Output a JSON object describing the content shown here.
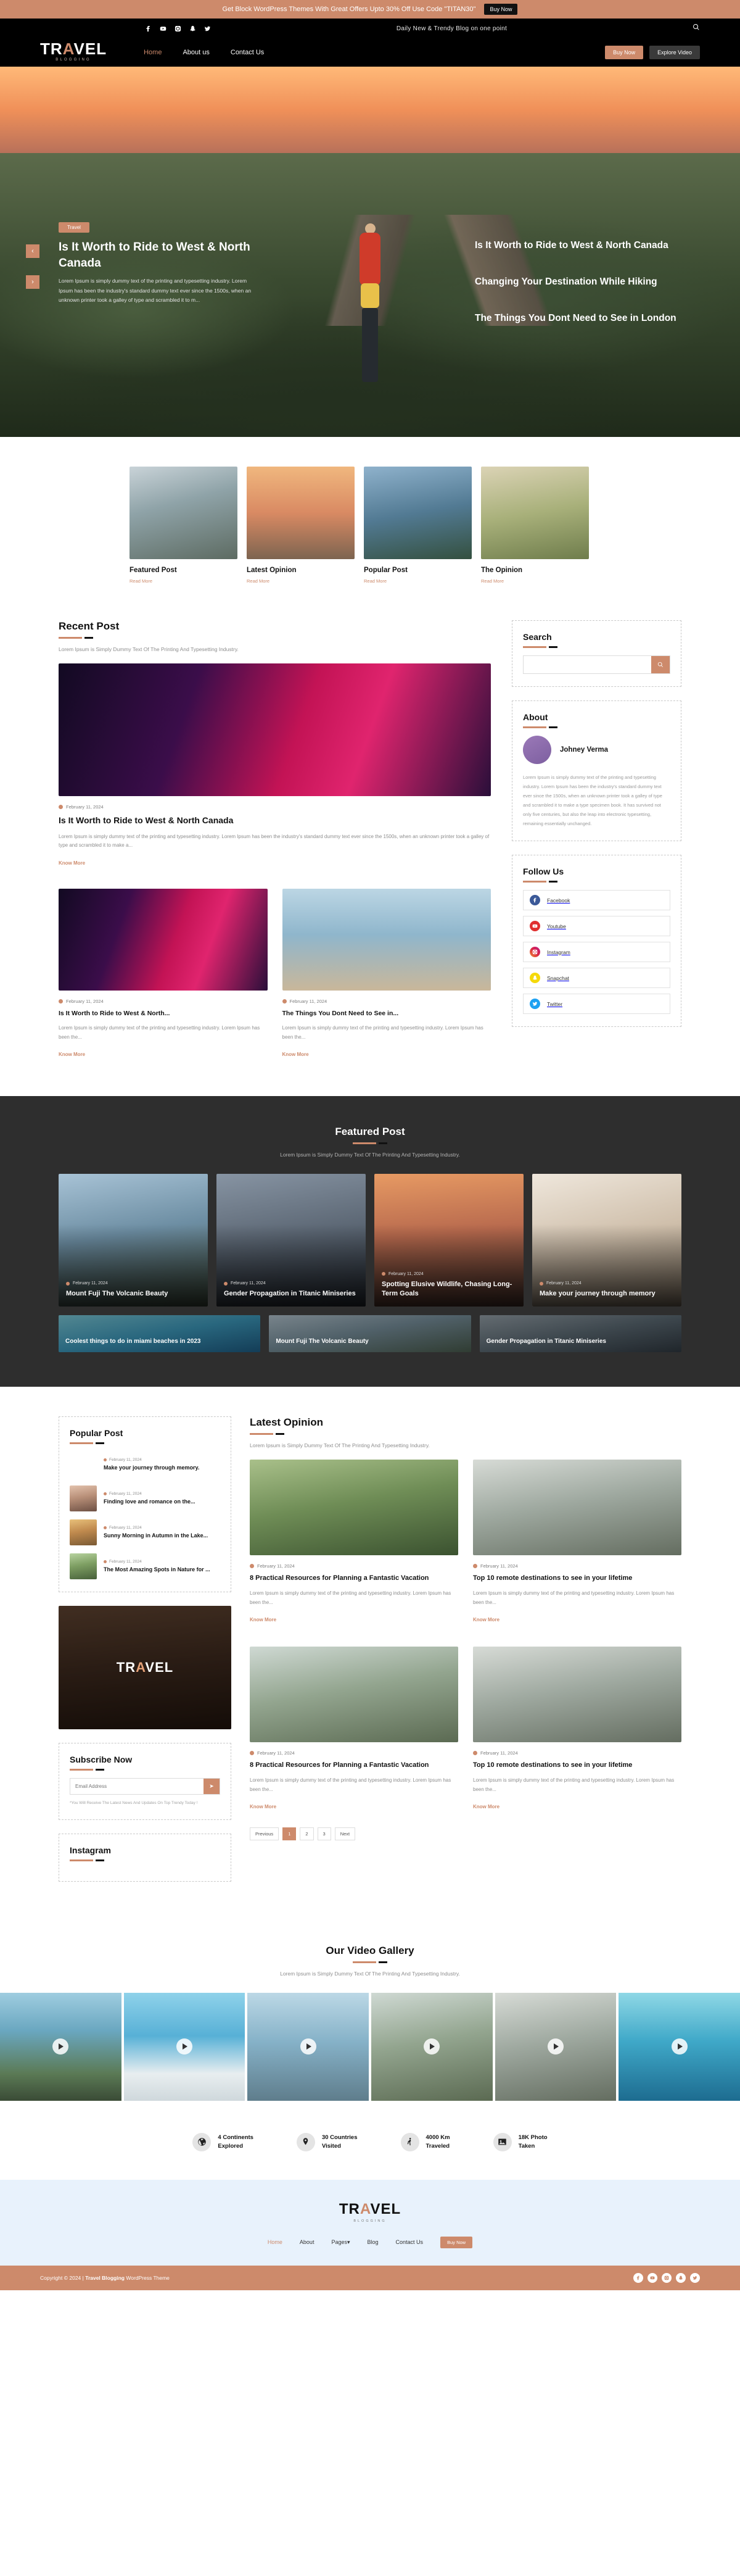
{
  "promo": {
    "text": "Get Block WordPress Themes With Great Offers Upto 30% Off Use Code \"TITAN30\"",
    "button": "Buy Now"
  },
  "topbar": {
    "tagline": "Daily New & Trendy Blog on one point",
    "socials": [
      "facebook-icon",
      "youtube-icon",
      "instagram-icon",
      "snapchat-icon",
      "twitter-icon"
    ],
    "search_icon": "search-icon"
  },
  "brand": {
    "main": "TRAVEL",
    "accent_letter": "A",
    "sub": "BLOGGING"
  },
  "nav": {
    "items": [
      {
        "label": "Home",
        "active": true
      },
      {
        "label": "About us",
        "active": false
      },
      {
        "label": "Contact Us",
        "active": false
      }
    ],
    "buy_now": "Buy Now",
    "explore": "Explore Video"
  },
  "hero": {
    "badge": "Travel",
    "title": "Is It Worth to Ride to West & North Canada",
    "paragraph": "Lorem Ipsum is simply dummy text of the printing and typesetting industry. Lorem Ipsum has been the industry's standard dummy text ever since the 1500s, when an unknown printer took a galley of type and scrambled it to m...",
    "slides": [
      "Is It Worth to Ride to West & North Canada",
      "Changing Your Destination While Hiking",
      "The Things You Dont Need to See in London"
    ],
    "arrow_up": "‹",
    "arrow_down": "›"
  },
  "categories": [
    {
      "title": "Featured Post",
      "link": "Read More",
      "img": "p-group"
    },
    {
      "title": "Latest Opinion",
      "link": "Read More",
      "img": "p-balloon"
    },
    {
      "title": "Popular Post",
      "link": "Read More",
      "img": "p-hiker"
    },
    {
      "title": "The Opinion",
      "link": "Read More",
      "img": "p-field"
    }
  ],
  "recent": {
    "title": "Recent Post",
    "subtitle": "Lorem Ipsum is Simply Dummy Text Of The Printing And Typesetting Industry.",
    "featured": {
      "date": "February 11, 2024",
      "heading": "Is It Worth to Ride to West & North Canada",
      "paragraph": "Lorem Ipsum is simply dummy text of the printing and typesetting industry. Lorem Ipsum has been the industry's standard dummy text ever since the 1500s, when an unknown printer took a galley of type and scrambled it to make a...",
      "link": "Know More",
      "img": "p-neon"
    },
    "grid": [
      {
        "date": "February 11, 2024",
        "heading": "Is It Worth to Ride to West & North...",
        "paragraph": "Lorem Ipsum is simply dummy text of the printing and typesetting industry. Lorem Ipsum has been the...",
        "link": "Know More",
        "img": "p-neon"
      },
      {
        "date": "February 11, 2024",
        "heading": "The Things You Dont Need to See in...",
        "paragraph": "Lorem Ipsum is simply dummy text of the printing and typesetting industry. Lorem Ipsum has been the...",
        "link": "Know More",
        "img": "p-beach"
      }
    ]
  },
  "sidebar": {
    "search": {
      "title": "Search",
      "placeholder": "",
      "value": "",
      "icon": "search-icon"
    },
    "about": {
      "title": "About",
      "name": "Johney Verma",
      "text": "Lorem Ipsum is simply dummy text of the printing and typesetting industry. Lorem Ipsum has been the industry's standard dummy text ever since the 1500s, when an unknown printer took a galley of type and scrambled it to make a type specimen book. It has survived not only five centuries, but also the leap into electronic typesetting, remaining essentially unchanged."
    },
    "follow": {
      "title": "Follow Us",
      "items": [
        {
          "label": "Facebook",
          "icon": "facebook-icon",
          "color": "#3b5998"
        },
        {
          "label": "Youtube",
          "icon": "youtube-icon",
          "color": "#e02f2f"
        },
        {
          "label": "Instagram",
          "icon": "instagram-icon",
          "color": "#d6249f"
        },
        {
          "label": "Snapchat",
          "icon": "snapchat-icon",
          "color": "#f5d90a"
        },
        {
          "label": "Twitter",
          "icon": "twitter-icon",
          "color": "#1da1f2"
        }
      ]
    }
  },
  "featured": {
    "title": "Featured Post",
    "subtitle": "Lorem Ipsum is Simply Dummy Text Of The Printing And Typesetting Industry.",
    "cards": [
      {
        "date": "February 11, 2024",
        "heading": "Mount Fuji The Volcanic Beauty",
        "img": "p-sit"
      },
      {
        "date": "February 11, 2024",
        "heading": "Gender Propagation in Titanic Miniseries",
        "img": "p-bigben"
      },
      {
        "date": "February 11, 2024",
        "heading": "Spotting Elusive Wildlife, Chasing Long-Term Goals",
        "img": "p-canal"
      },
      {
        "date": "February 11, 2024",
        "heading": "Make your journey through memory",
        "img": "p-desk"
      }
    ],
    "strip": [
      {
        "heading": "Coolest things to do in miami beaches in 2023",
        "img": "p-blue"
      },
      {
        "heading": "Mount Fuji The Volcanic Beauty",
        "img": "p-mountbig"
      },
      {
        "heading": "Gender Propagation in Titanic Miniseries",
        "img": "p-titanic"
      }
    ]
  },
  "popular": {
    "title": "Popular Post",
    "items": [
      {
        "date": "February 11, 2024",
        "heading": "Make your journey through memory.",
        "img": "p-memory"
      },
      {
        "date": "February 11, 2024",
        "heading": "Finding love and romance on the...",
        "img": "p-romance"
      },
      {
        "date": "February 11, 2024",
        "heading": "Sunny Morning in Autumn in the Lake...",
        "img": "p-autumn"
      },
      {
        "date": "February 11, 2024",
        "heading": "The Most Amazing Spots in Nature for ...",
        "img": "p-nature"
      }
    ]
  },
  "promo_card": {
    "logo": "TRAVEL",
    "img": "p-tent"
  },
  "subscribe": {
    "title": "Subscribe Now",
    "placeholder": "Email Address",
    "value": "",
    "button_icon": "send-icon",
    "note": "*You Will Receive The Latest News And Updates On Top Trendy Today !"
  },
  "instagram": {
    "title": "Instagram"
  },
  "latest": {
    "title": "Latest Opinion",
    "subtitle": "Lorem Ipsum is Simply Dummy Text Of The Printing And Typesetting Industry.",
    "cards": [
      {
        "date": "February 11, 2024",
        "heading": "8 Practical Resources for Planning a Fantastic Vacation",
        "paragraph": "Lorem Ipsum is simply dummy text of the printing and typesetting industry. Lorem Ipsum has been the...",
        "link": "Know More",
        "img": "p-forest"
      },
      {
        "date": "February 11, 2024",
        "heading": "Top 10 remote destinations to see in your lifetime",
        "paragraph": "Lorem Ipsum is simply dummy text of the printing and typesetting industry. Lorem Ipsum has been the...",
        "link": "Know More",
        "img": "p-dance"
      },
      {
        "date": "February 11, 2024",
        "heading": "8 Practical Resources for Planning a Fantastic Vacation",
        "paragraph": "Lorem Ipsum is simply dummy text of the printing and typesetting industry. Lorem Ipsum has been the...",
        "link": "Know More",
        "img": "p-couple"
      },
      {
        "date": "February 11, 2024",
        "heading": "Top 10 remote destinations to see in your lifetime",
        "paragraph": "Lorem Ipsum is simply dummy text of the printing and typesetting industry. Lorem Ipsum has been the...",
        "link": "Know More",
        "img": "p-dance"
      }
    ],
    "pagination": {
      "prev": "Previous",
      "pages": [
        "1",
        "2",
        "3"
      ],
      "next": "Next",
      "current": "1"
    }
  },
  "gallery": {
    "title": "Our Video Gallery",
    "subtitle": "Lorem Ipsum is Simply Dummy Text Of The Printing And Typesetting Industry.",
    "items": [
      "p-road",
      "p-santorini",
      "p-boat",
      "p-couple",
      "p-dance",
      "p-kayak"
    ]
  },
  "stats": [
    {
      "icon": "globe-icon",
      "line1": "4 Continents",
      "line2": "Explored"
    },
    {
      "icon": "map-pin-icon",
      "line1": "30 Countries",
      "line2": "Visited"
    },
    {
      "icon": "hiker-icon",
      "line1": "4000 Km",
      "line2": "Traveled"
    },
    {
      "icon": "photo-icon",
      "line1": "18K Photo",
      "line2": "Taken"
    }
  ],
  "footer": {
    "logo": "TRAVEL",
    "logo_sub": "BLOGGING",
    "menu": [
      {
        "label": "Home",
        "active": true
      },
      {
        "label": "About",
        "active": false
      },
      {
        "label": "Pages",
        "active": false,
        "caret": "▾"
      },
      {
        "label": "Blog",
        "active": false
      },
      {
        "label": "Contact Us",
        "active": false
      }
    ],
    "buy_now": "Buy Now",
    "copyright_pre": "Copyright © 2024 |",
    "copyright_brand": "Travel Blogging",
    "copyright_post": "WordPress Theme",
    "socials": [
      "facebook-icon",
      "youtube-icon",
      "instagram-icon",
      "snapchat-icon",
      "twitter-icon"
    ]
  }
}
